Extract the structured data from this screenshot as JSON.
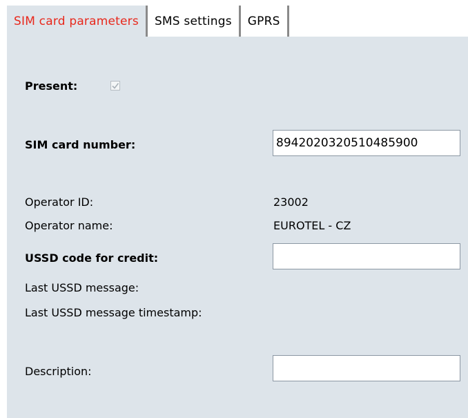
{
  "tabs": [
    {
      "label": "SIM card parameters",
      "active": true
    },
    {
      "label": "SMS settings",
      "active": false
    },
    {
      "label": "GPRS",
      "active": false
    }
  ],
  "form": {
    "present_label": "Present:",
    "present_checked": true,
    "sim_number_label": "SIM card number:",
    "sim_number_value": "8942020320510485900",
    "operator_id_label": "Operator ID:",
    "operator_id_value": "23002",
    "operator_name_label": "Operator name:",
    "operator_name_value": "EUROTEL - CZ",
    "ussd_code_label": "USSD code for credit:",
    "ussd_code_value": "",
    "last_ussd_label": "Last USSD message:",
    "last_ussd_timestamp_label": "Last USSD message timestamp:",
    "description_label": "Description:",
    "description_value": ""
  },
  "colors": {
    "active_tab_text": "#e8281c",
    "panel_background": "#dde4ea",
    "tab_separator": "#8a8a8a"
  }
}
